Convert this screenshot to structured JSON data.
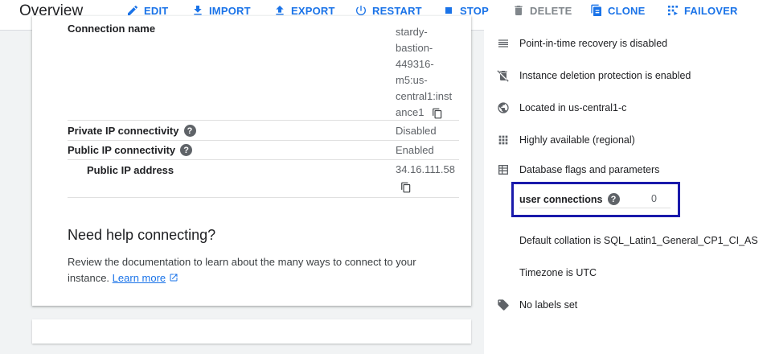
{
  "header": {
    "title": "Overview",
    "actions": [
      {
        "label": "EDIT",
        "icon": "edit-icon",
        "enabled": true
      },
      {
        "label": "IMPORT",
        "icon": "import-icon",
        "enabled": true
      },
      {
        "label": "EXPORT",
        "icon": "export-icon",
        "enabled": true
      },
      {
        "label": "RESTART",
        "icon": "restart-icon",
        "enabled": true
      },
      {
        "label": "STOP",
        "icon": "stop-icon",
        "enabled": true
      },
      {
        "label": "DELETE",
        "icon": "delete-icon",
        "enabled": false
      },
      {
        "label": "CLONE",
        "icon": "clone-icon",
        "enabled": true
      },
      {
        "label": "FAILOVER",
        "icon": "failover-icon",
        "enabled": true
      }
    ]
  },
  "connection": {
    "name_label": "Connection name",
    "name_lines": [
      "stardy-",
      "bastion-",
      "449316-",
      "m5:us-",
      "central1:inst",
      "ance1"
    ],
    "rows": [
      {
        "label": "Private IP connectivity",
        "value": "Disabled"
      },
      {
        "label": "Public IP connectivity",
        "value": "Enabled"
      },
      {
        "label": "Public IP address",
        "value": "34.16.111.58"
      }
    ]
  },
  "help": {
    "heading": "Need help connecting?",
    "text": "Review the documentation to learn about the many ways to connect to your instance.",
    "link": "Learn more"
  },
  "config": {
    "items": [
      {
        "icon": "list-icon",
        "text": "Point-in-time recovery is disabled"
      },
      {
        "icon": "delete-protection-icon",
        "text": "Instance deletion protection is enabled"
      },
      {
        "icon": "globe-icon",
        "text": "Located in us-central1-c"
      },
      {
        "icon": "grid-icon",
        "text": "Highly available (regional)"
      },
      {
        "icon": "table-icon",
        "text": "Database flags and parameters"
      }
    ],
    "flag": {
      "name": "user connections",
      "value": "0"
    },
    "collation": "Default collation is SQL_Latin1_General_CP1_CI_AS",
    "timezone": "Timezone is UTC",
    "labels": {
      "icon": "label-icon",
      "text": "No labels set"
    }
  },
  "colors": {
    "accent": "#1a73e8",
    "highlight_box": "#1a1aab"
  }
}
